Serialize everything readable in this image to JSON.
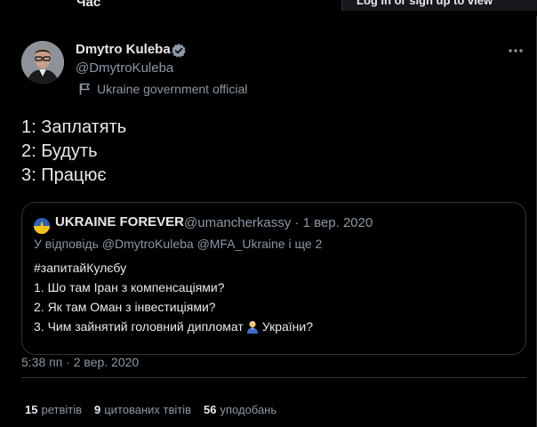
{
  "top": {
    "cut_text": "Час",
    "login_banner": "Log in or sign up to view"
  },
  "tweet": {
    "author_name": "Dmytro Kuleba",
    "handle": "@DmytroKuleba",
    "gov_label": "Ukraine government official",
    "lines": [
      "1: Заплатять",
      "2: Будуть",
      "3: Працює"
    ],
    "timestamp": "5:38 пп · 2 вер. 2020"
  },
  "quoted": {
    "author_name": "UKRAINE FOREVER",
    "handle": "@umancherkassy",
    "date": "1 вер. 2020",
    "reply_to": "У відповідь @DmytroKuleba @MFA_Ukraine і ще 2",
    "lines": [
      "#запитайКулєбу",
      "1. Шо там Іран з компенсаціями?",
      "2. Як там Оман з інвестиціями?"
    ],
    "line3_before": "3. Чим зайнятий головний дипломат",
    "line3_after": "України?"
  },
  "stats": {
    "retweets_count": "15",
    "retweets_label": "ретвітів",
    "quotes_count": "9",
    "quotes_label": "цитованих твітів",
    "likes_count": "56",
    "likes_label": "уподобань"
  },
  "colors": {
    "background": "#000000",
    "text_primary": "#e7e9ea",
    "text_secondary": "#8b98a5",
    "border": "#2f3336",
    "verified": "#8b98a5"
  },
  "icons": [
    "verified-badge-icon",
    "flag-icon",
    "more-icon",
    "person-emoji-icon",
    "quoted-avatar-icon"
  ]
}
